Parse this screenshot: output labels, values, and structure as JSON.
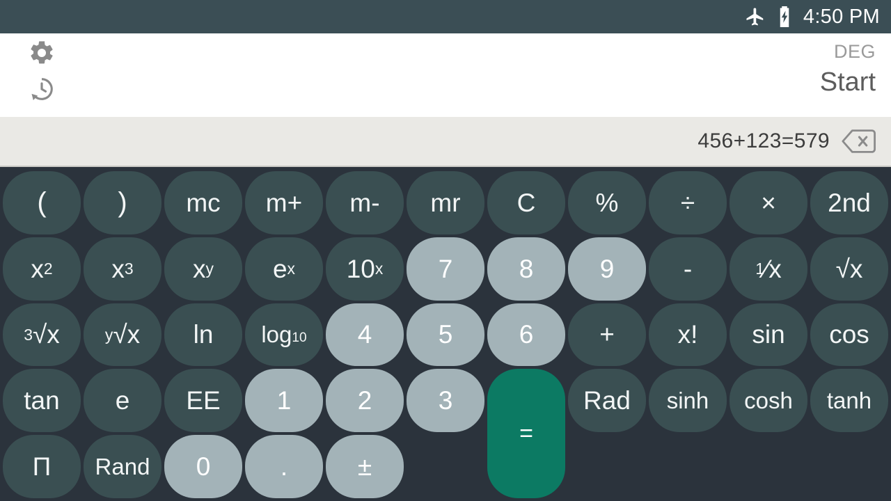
{
  "status_bar": {
    "airplane_icon": "airplane-icon",
    "battery_icon": "battery-charging-icon",
    "time": "4:50 PM",
    "background_color": "#3b4e55"
  },
  "header": {
    "settings_icon": "gear-icon",
    "history_icon": "history-clock-icon",
    "angle_mode": "DEG",
    "start_label": "Start",
    "background_color": "#ffffff"
  },
  "expression": {
    "text": "456+123=579",
    "backspace_icon": "backspace-icon",
    "background_color": "#eae9e5"
  },
  "theme": {
    "keypad_background": "#2b333c",
    "function_key_color": "#3a4f52",
    "number_key_color": "#a3b3b8",
    "equals_key_color": "#0c7a63",
    "key_text_color": "#ffffff"
  },
  "keypad": {
    "rows": [
      [
        {
          "label": "(",
          "name": "key-open-paren",
          "type": "fn",
          "style": "paren"
        },
        {
          "label": ")",
          "name": "key-close-paren",
          "type": "fn",
          "style": "paren"
        },
        {
          "label": "mc",
          "name": "key-memory-clear",
          "type": "fn"
        },
        {
          "label": "m+",
          "name": "key-memory-add",
          "type": "fn"
        },
        {
          "label": "m-",
          "name": "key-memory-subtract",
          "type": "fn"
        },
        {
          "label": "mr",
          "name": "key-memory-recall",
          "type": "fn"
        },
        {
          "label": "C",
          "name": "key-clear",
          "type": "fn"
        },
        {
          "label": "%",
          "name": "key-percent",
          "type": "fn"
        },
        {
          "label": "÷",
          "name": "key-divide",
          "type": "fn"
        },
        {
          "label": "×",
          "name": "key-multiply",
          "type": "fn"
        }
      ],
      [
        {
          "label": "2nd",
          "name": "key-second",
          "type": "fn"
        },
        {
          "label": "x²",
          "name": "key-square",
          "type": "fn",
          "html": "x<sup>2</sup>"
        },
        {
          "label": "x³",
          "name": "key-cube",
          "type": "fn",
          "html": "x<sup>3</sup>"
        },
        {
          "label": "xʸ",
          "name": "key-power",
          "type": "fn",
          "html": "x<sup>y</sup>"
        },
        {
          "label": "eˣ",
          "name": "key-exp-e",
          "type": "fn",
          "html": "e<sup>x</sup>"
        },
        {
          "label": "10ˣ",
          "name": "key-exp-ten",
          "type": "fn",
          "html": "10<sup>x</sup>"
        },
        {
          "label": "7",
          "name": "key-7",
          "type": "num"
        },
        {
          "label": "8",
          "name": "key-8",
          "type": "num"
        },
        {
          "label": "9",
          "name": "key-9",
          "type": "num"
        },
        {
          "label": "-",
          "name": "key-subtract",
          "type": "fn"
        }
      ],
      [
        {
          "label": "¹⁄x",
          "name": "key-reciprocal",
          "type": "fn",
          "html": "<span class=\"pre\">1</span>⁄x"
        },
        {
          "label": "√x",
          "name": "key-square-root",
          "type": "fn"
        },
        {
          "label": "³√x",
          "name": "key-cube-root",
          "type": "fn",
          "html": "<span class=\"pre\">3</span>√x"
        },
        {
          "label": "ʸ√x",
          "name": "key-nth-root",
          "type": "fn",
          "html": "<span class=\"pre\">y</span>√x"
        },
        {
          "label": "ln",
          "name": "key-natural-log",
          "type": "fn"
        },
        {
          "label": "log₁₀",
          "name": "key-log-base-ten",
          "type": "fn",
          "html": "log<sub>10</sub>",
          "style": "small"
        },
        {
          "label": "4",
          "name": "key-4",
          "type": "num"
        },
        {
          "label": "5",
          "name": "key-5",
          "type": "num"
        },
        {
          "label": "6",
          "name": "key-6",
          "type": "num"
        },
        {
          "label": "+",
          "name": "key-add",
          "type": "fn"
        }
      ],
      [
        {
          "label": "x!",
          "name": "key-factorial",
          "type": "fn"
        },
        {
          "label": "sin",
          "name": "key-sin",
          "type": "fn"
        },
        {
          "label": "cos",
          "name": "key-cos",
          "type": "fn"
        },
        {
          "label": "tan",
          "name": "key-tan",
          "type": "fn"
        },
        {
          "label": "e",
          "name": "key-euler",
          "type": "fn"
        },
        {
          "label": "EE",
          "name": "key-ee",
          "type": "fn"
        },
        {
          "label": "1",
          "name": "key-1",
          "type": "num"
        },
        {
          "label": "2",
          "name": "key-2",
          "type": "num"
        },
        {
          "label": "3",
          "name": "key-3",
          "type": "num"
        },
        {
          "label": "=",
          "name": "key-equals",
          "type": "equals"
        }
      ],
      [
        {
          "label": "Rad",
          "name": "key-rad",
          "type": "fn"
        },
        {
          "label": "sinh",
          "name": "key-sinh",
          "type": "fn",
          "style": "small"
        },
        {
          "label": "cosh",
          "name": "key-cosh",
          "type": "fn",
          "style": "small"
        },
        {
          "label": "tanh",
          "name": "key-tanh",
          "type": "fn",
          "style": "small"
        },
        {
          "label": "Π",
          "name": "key-pi",
          "type": "fn"
        },
        {
          "label": "Rand",
          "name": "key-random",
          "type": "fn",
          "style": "small"
        },
        {
          "label": "0",
          "name": "key-0",
          "type": "num"
        },
        {
          "label": ".",
          "name": "key-decimal",
          "type": "num"
        },
        {
          "label": "±",
          "name": "key-sign-toggle",
          "type": "num"
        }
      ]
    ]
  }
}
